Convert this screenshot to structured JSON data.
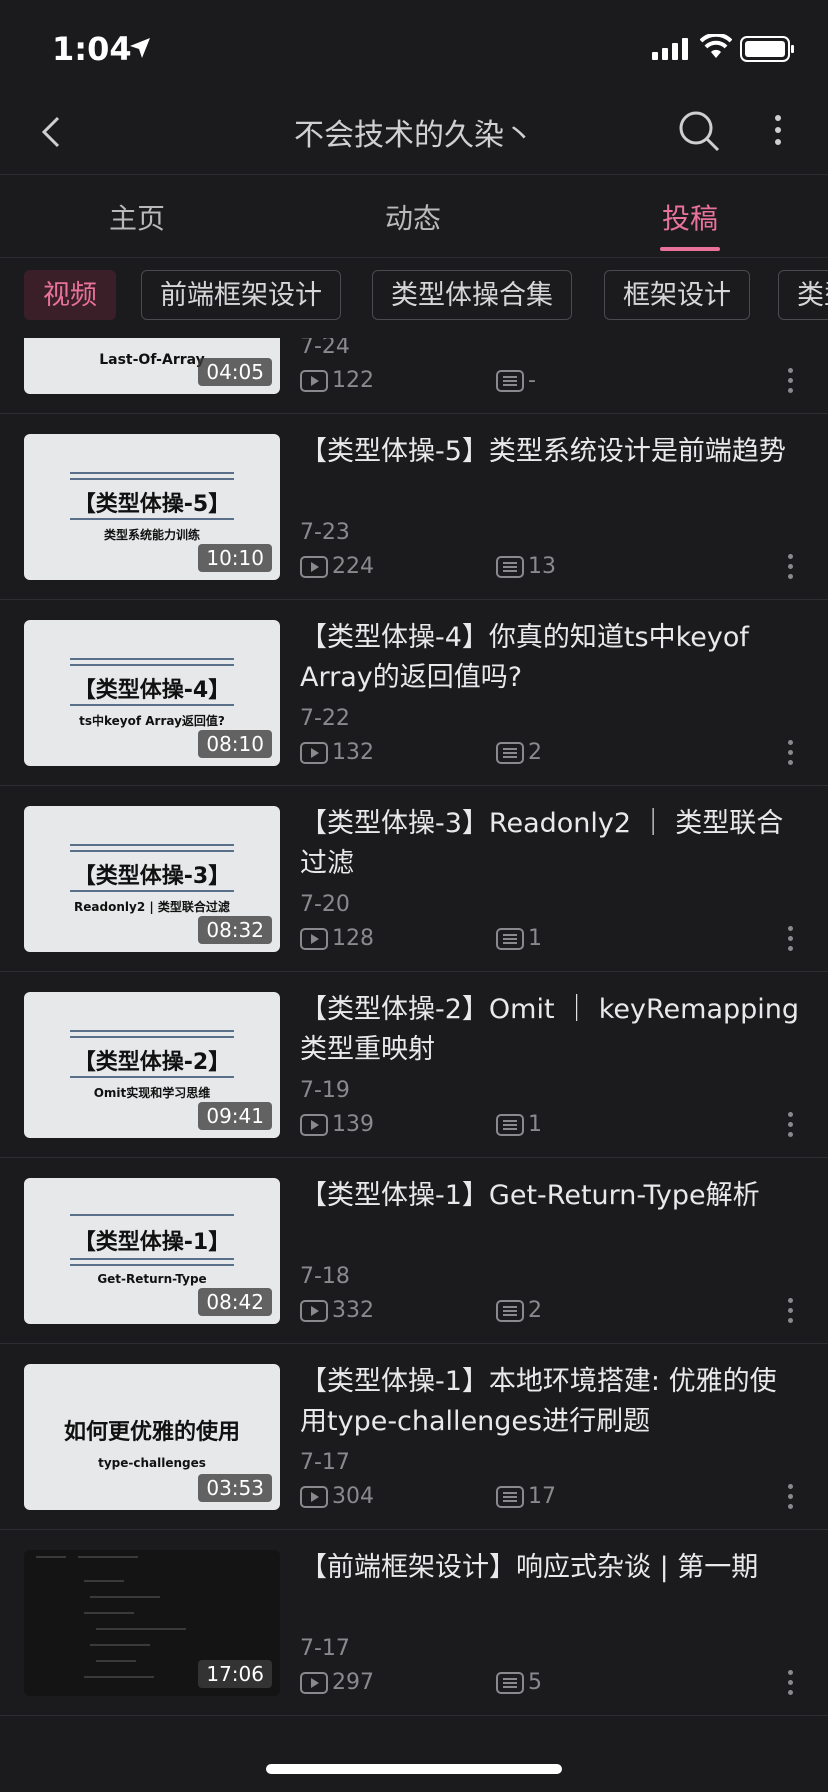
{
  "status_bar": {
    "time": "1:04"
  },
  "nav": {
    "title": "不会技术的久染丶"
  },
  "tabs": [
    {
      "label": "主页"
    },
    {
      "label": "动态"
    },
    {
      "label": "投稿"
    }
  ],
  "chips": [
    {
      "label": "视频"
    },
    {
      "label": "前端框架设计"
    },
    {
      "label": "类型体操合集"
    },
    {
      "label": "框架设计"
    },
    {
      "label": "类型"
    }
  ],
  "videos": [
    {
      "thumb_small": "Last-Of-Array",
      "duration": "04:05",
      "title": "",
      "date": "7-24",
      "plays": "122",
      "comments": "-"
    },
    {
      "thumb_big": "【类型体操-5】",
      "thumb_small": "类型系统能力训练",
      "duration": "10:10",
      "title": "【类型体操-5】类型系统设计是前端趋势",
      "date": "7-23",
      "plays": "224",
      "comments": "13"
    },
    {
      "thumb_big": "【类型体操-4】",
      "thumb_small": "ts中keyof Array返回值?",
      "duration": "08:10",
      "title": "【类型体操-4】你真的知道ts中keyof Array的返回值吗?",
      "date": "7-22",
      "plays": "132",
      "comments": "2"
    },
    {
      "thumb_big": "【类型体操-3】",
      "thumb_small": "Readonly2 | 类型联合过滤",
      "duration": "08:32",
      "title": "【类型体操-3】Readonly2 ｜ 类型联合过滤",
      "date": "7-20",
      "plays": "128",
      "comments": "1"
    },
    {
      "thumb_big": "【类型体操-2】",
      "thumb_small": "Omit实现和学习思维",
      "duration": "09:41",
      "title": "【类型体操-2】Omit ｜ keyRemapping类型重映射",
      "date": "7-19",
      "plays": "139",
      "comments": "1"
    },
    {
      "thumb_big": "【类型体操-1】",
      "thumb_small": "Get-Return-Type",
      "duration": "08:42",
      "title": "【类型体操-1】Get-Return-Type解析",
      "date": "7-18",
      "plays": "332",
      "comments": "2"
    },
    {
      "thumb_big": "如何更优雅的使用",
      "thumb_small": "type-challenges",
      "duration": "03:53",
      "title": "【类型体操-1】本地环境搭建: 优雅的使用type-challenges进行刷题",
      "date": "7-17",
      "plays": "304",
      "comments": "17"
    },
    {
      "duration": "17:06",
      "title": "【前端框架设计】响应式杂谈 | 第一期",
      "date": "7-17",
      "plays": "297",
      "comments": "5"
    }
  ]
}
